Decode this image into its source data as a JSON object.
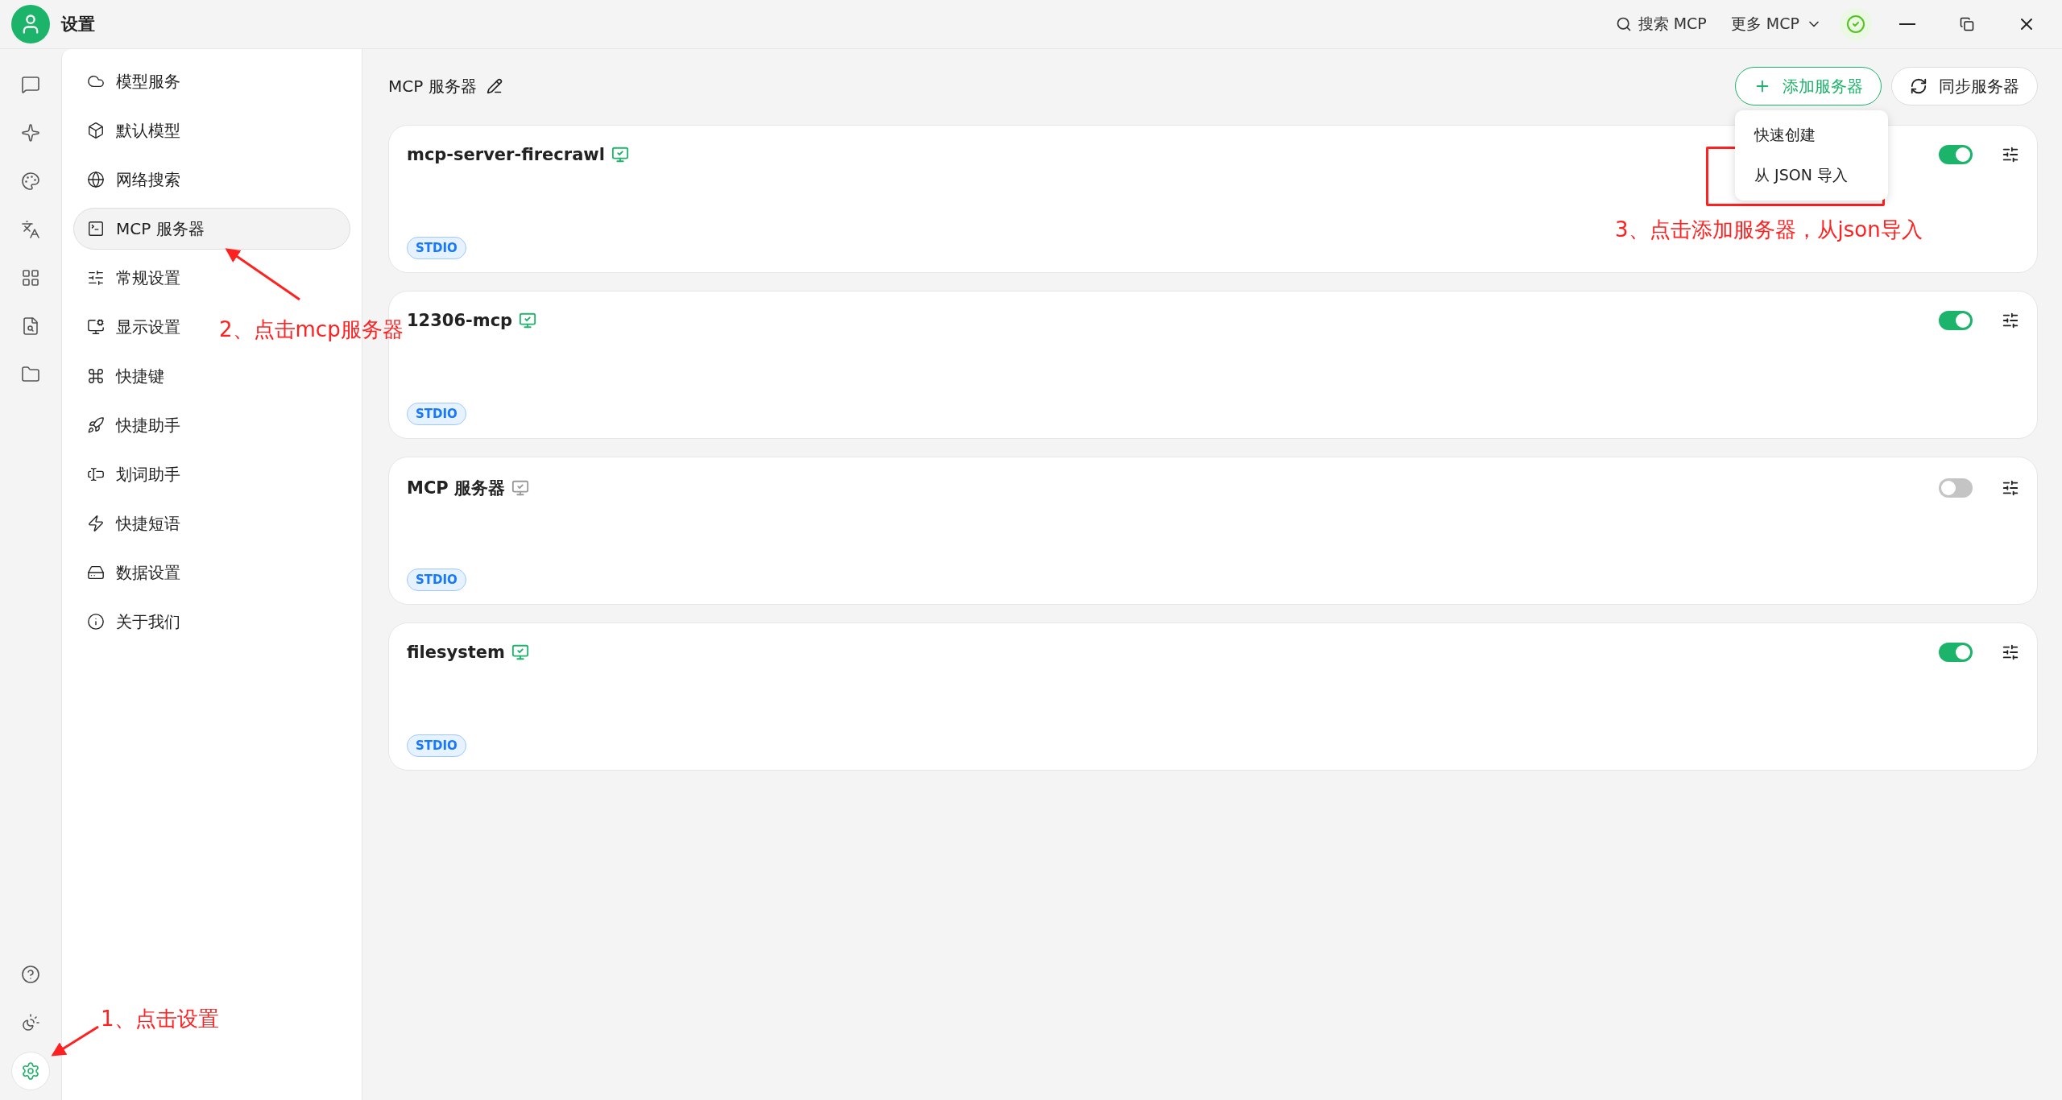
{
  "window": {
    "title": "设置",
    "search_label": "搜索 MCP",
    "more_label": "更多 MCP"
  },
  "rail": {
    "top": [
      {
        "selected": false
      },
      {
        "selected": false
      },
      {
        "selected": false
      },
      {
        "selected": false
      },
      {
        "selected": false
      },
      {
        "selected": false
      },
      {
        "selected": false
      }
    ],
    "bottom": [
      {
        "selected": false
      },
      {
        "selected": false
      },
      {
        "selected": true
      }
    ]
  },
  "settings_menu": [
    {
      "label": "模型服务",
      "selected": false
    },
    {
      "label": "默认模型",
      "selected": false
    },
    {
      "label": "网络搜索",
      "selected": false
    },
    {
      "label": "MCP 服务器",
      "selected": true
    },
    {
      "label": "常规设置",
      "selected": false
    },
    {
      "label": "显示设置",
      "selected": false
    },
    {
      "label": "快捷键",
      "selected": false
    },
    {
      "label": "快捷助手",
      "selected": false
    },
    {
      "label": "划词助手",
      "selected": false
    },
    {
      "label": "快捷短语",
      "selected": false
    },
    {
      "label": "数据设置",
      "selected": false
    },
    {
      "label": "关于我们",
      "selected": false
    }
  ],
  "header": {
    "title": "MCP 服务器",
    "add_button": "添加服务器",
    "sync_button": "同步服务器"
  },
  "add_menu": [
    {
      "label": "快速创建"
    },
    {
      "label": "从 JSON 导入"
    }
  ],
  "servers": [
    {
      "name": "mcp-server-firecrawl",
      "on": true,
      "tag": "STDIO"
    },
    {
      "name": "12306-mcp",
      "on": true,
      "tag": "STDIO"
    },
    {
      "name": "MCP 服务器",
      "on": false,
      "tag": "STDIO"
    },
    {
      "name": "filesystem",
      "on": true,
      "tag": "STDIO"
    }
  ],
  "annotations": [
    {
      "text": "1、点击设置"
    },
    {
      "text": "2、点击mcp服务器"
    },
    {
      "text": "3、点击添加服务器，从json导入"
    }
  ]
}
